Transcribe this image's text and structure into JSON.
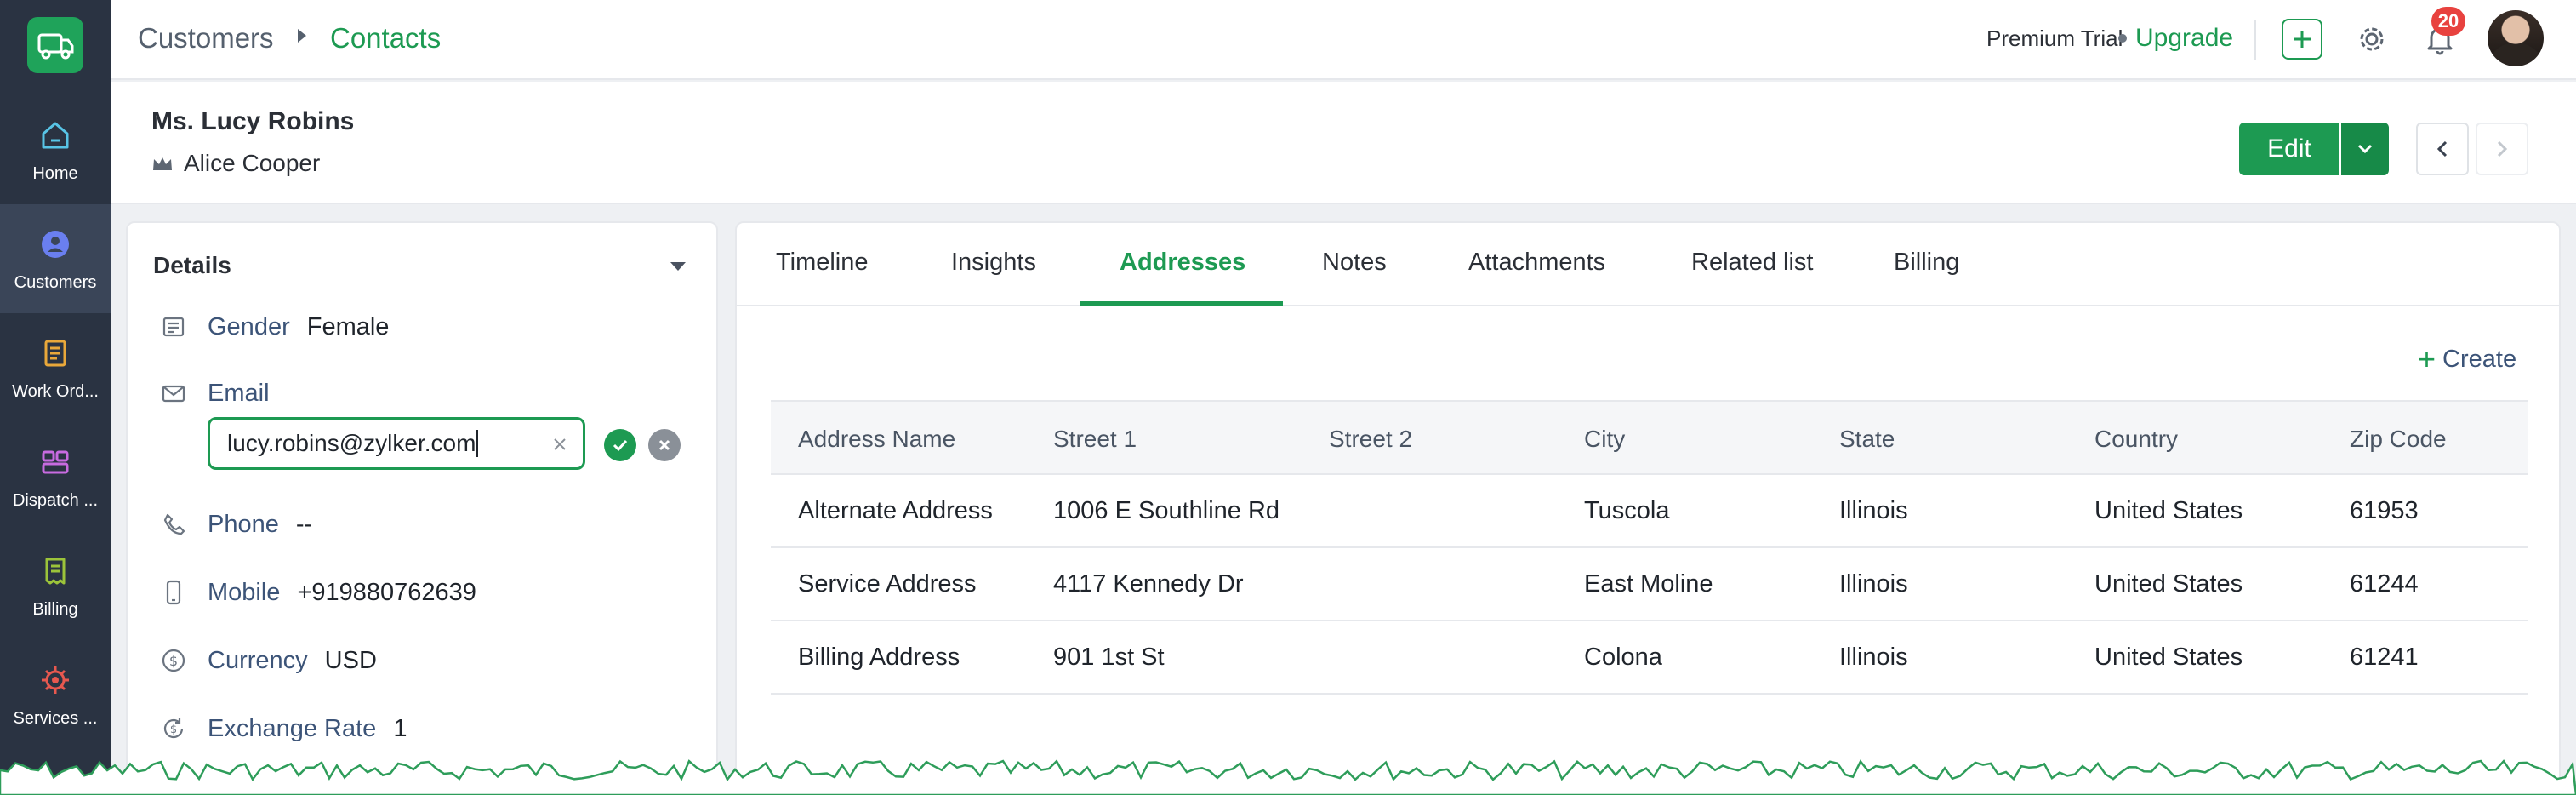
{
  "sidebar": {
    "items": [
      {
        "label": "Home",
        "icon": "home-icon"
      },
      {
        "label": "Customers",
        "icon": "customers-icon"
      },
      {
        "label": "Work Ord...",
        "icon": "work-orders-icon"
      },
      {
        "label": "Dispatch ...",
        "icon": "dispatch-icon"
      },
      {
        "label": "Billing",
        "icon": "billing-icon"
      },
      {
        "label": "Services ...",
        "icon": "services-icon"
      }
    ],
    "active_index": 1
  },
  "header": {
    "breadcrumb": [
      "Customers",
      "Contacts"
    ],
    "trial_text": "Premium Trial",
    "upgrade_label": "Upgrade",
    "notification_count": "20"
  },
  "record": {
    "name": "Ms. Lucy Robins",
    "owner": "Alice Cooper",
    "edit_label": "Edit"
  },
  "details": {
    "title": "Details",
    "fields": [
      {
        "label": "Gender",
        "value": "Female"
      },
      {
        "label": "Email",
        "value": "lucy.robins@zylker.com"
      },
      {
        "label": "Phone",
        "value": "--"
      },
      {
        "label": "Mobile",
        "value": "+919880762639"
      },
      {
        "label": "Currency",
        "value": "USD"
      },
      {
        "label": "Exchange Rate",
        "value": "1"
      }
    ]
  },
  "tabs": [
    {
      "label": "Timeline"
    },
    {
      "label": "Insights"
    },
    {
      "label": "Addresses"
    },
    {
      "label": "Notes"
    },
    {
      "label": "Attachments"
    },
    {
      "label": "Related list"
    },
    {
      "label": "Billing"
    }
  ],
  "active_tab": "Addresses",
  "addresses": {
    "create_label": "Create",
    "columns": [
      "Address Name",
      "Street 1",
      "Street 2",
      "City",
      "State",
      "Country",
      "Zip Code"
    ],
    "rows": [
      [
        "Alternate Address",
        "1006 E Southline Rd",
        "",
        "Tuscola",
        "Illinois",
        "United States",
        "61953"
      ],
      [
        "Service Address",
        "4117 Kennedy Dr",
        "",
        "East Moline",
        "Illinois",
        "United States",
        "61244"
      ],
      [
        "Billing Address",
        "901 1st St",
        "",
        "Colona",
        "Illinois",
        "United States",
        "61241"
      ]
    ]
  },
  "colors": {
    "brand_green": "#1d9a52",
    "sidebar_bg": "#2a3342",
    "badge_red": "#e8423f"
  }
}
